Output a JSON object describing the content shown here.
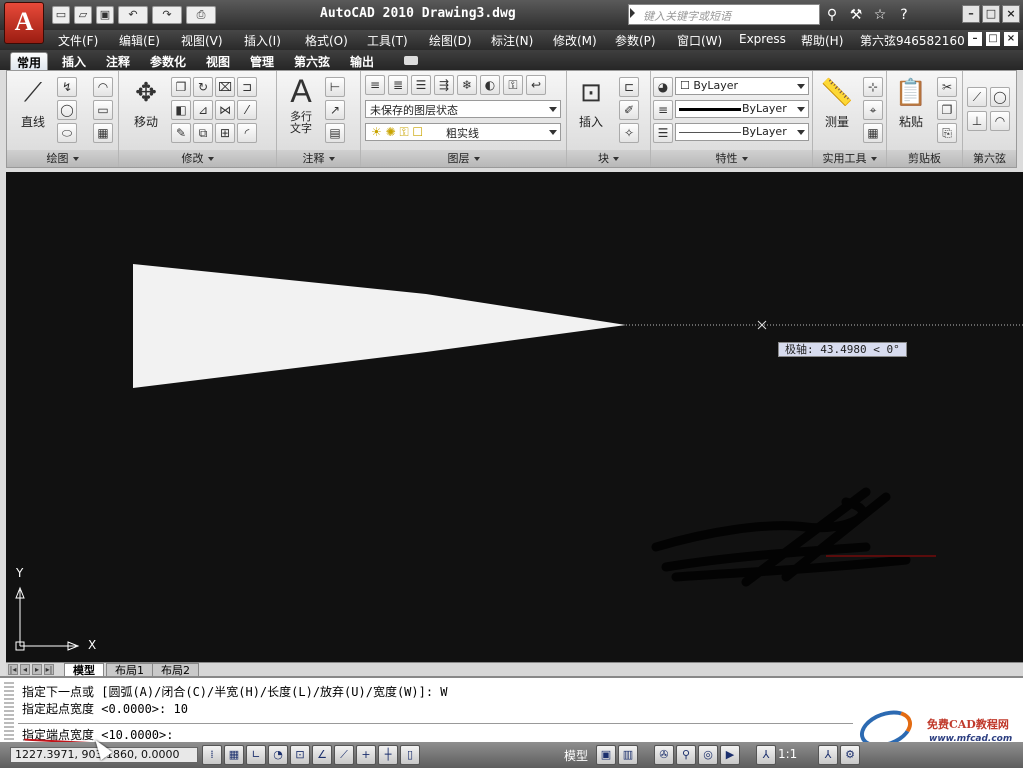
{
  "app": {
    "title": "AutoCAD 2010   Drawing3.dwg",
    "logo_letter": "A",
    "search_placeholder": "键入关键字或短语"
  },
  "qat": {
    "icons": [
      "new-icon",
      "open-icon",
      "save-icon",
      "undo-icon",
      "redo-icon",
      "print-icon"
    ],
    "glyphs": [
      "▭",
      "▱",
      "▣",
      "↶",
      "↷",
      "⎙"
    ]
  },
  "title_tools": {
    "glyphs": [
      "⚲",
      "⚒",
      "☆",
      "?"
    ]
  },
  "window_controls": {
    "minimize": "–",
    "restore": "□",
    "close": "×"
  },
  "menu": {
    "items": [
      "文件(F)",
      "编辑(E)",
      "视图(V)",
      "插入(I)",
      "格式(O)",
      "工具(T)",
      "绘图(D)",
      "标注(N)",
      "修改(M)",
      "参数(P)",
      "窗口(W)",
      "Express",
      "帮助(H)",
      "第六弦946582160"
    ]
  },
  "ribbon_tabs": [
    "常用",
    "插入",
    "注释",
    "参数化",
    "视图",
    "管理",
    "第六弦",
    "输出"
  ],
  "ribbon": {
    "draw": {
      "title": "绘图",
      "line_label": "直线"
    },
    "modify": {
      "title": "修改",
      "move_label": "移动"
    },
    "annotate": {
      "title": "注释",
      "mtext_label": "多行\n文字"
    },
    "layers": {
      "title": "图层",
      "state_combo": "未保存的图层状态",
      "layer_combo": "粗实线"
    },
    "block": {
      "title": "块",
      "insert_label": "插入"
    },
    "properties": {
      "title": "特性",
      "color_combo": "ByLayer",
      "linetype_combo": "ByLayer",
      "lineweight_combo": "ByLayer"
    },
    "utilities": {
      "title": "实用工具",
      "measure_label": "测量"
    },
    "clipboard": {
      "title": "剪贴板",
      "paste_label": "粘贴"
    },
    "custom": {
      "title": "第六弦"
    }
  },
  "drawing": {
    "tooltip": "极轴: 43.4980 < 0°",
    "ucs_x": "X",
    "ucs_y": "Y"
  },
  "layout_tabs": [
    "模型",
    "布局1",
    "布局2"
  ],
  "command": {
    "line1": "指定下一点或 [圆弧(A)/闭合(C)/半宽(H)/长度(L)/放弃(U)/宽度(W)]: W",
    "line2": "指定起点宽度 <0.0000>: 10",
    "line3": "指定端点宽度 <10.0000>:"
  },
  "watermark": {
    "name": "免费CAD教程网",
    "url": "www.mfcad.com"
  },
  "status": {
    "coords": "1227.3971, 903.1860, 0.0000",
    "model": "模型",
    "scale": "1:1"
  }
}
